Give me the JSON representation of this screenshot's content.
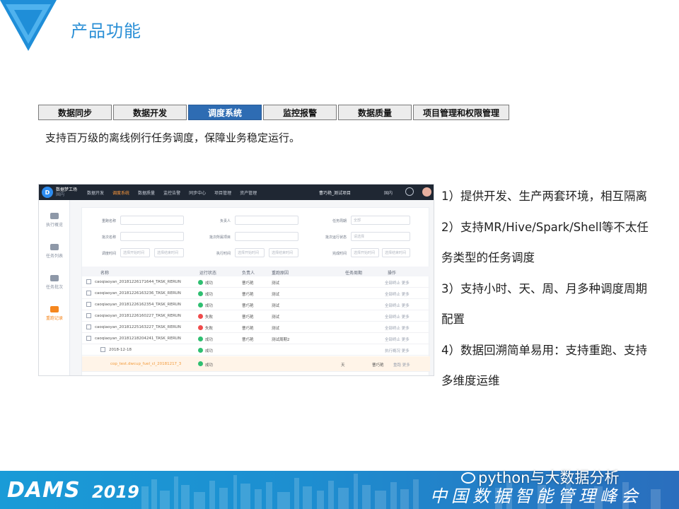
{
  "slide_title": "产品功能",
  "tabs": [
    {
      "label": "数据同步",
      "active": false
    },
    {
      "label": "数据开发",
      "active": false
    },
    {
      "label": "调度系统",
      "active": true
    },
    {
      "label": "监控报警",
      "active": false
    },
    {
      "label": "数据质量",
      "active": false
    },
    {
      "label": "项目管理和权限管理",
      "active": false
    }
  ],
  "subtitle": "支持百万级的离线例行任务调度，保障业务稳定运行。",
  "screenshot": {
    "brand": "数据梦工场",
    "brand_sub": "国内",
    "nav": [
      "数据开发",
      "调度系统",
      "数据质量",
      "监控告警",
      "同步中心",
      "项目管理",
      "资产管理"
    ],
    "nav_active_index": 1,
    "project": "曹巧艳_测试项目",
    "region": "国内",
    "sidebar": [
      {
        "label": "执行概览",
        "active": false
      },
      {
        "label": "任务列表",
        "active": false
      },
      {
        "label": "任务批次",
        "active": false
      },
      {
        "label": "重跑记录",
        "active": true
      }
    ],
    "filters": {
      "row1": [
        {
          "label": "重跑名称",
          "value": ""
        },
        {
          "label": "负责人",
          "value": ""
        },
        {
          "label": "任务周期",
          "value": "全部"
        }
      ],
      "row2": [
        {
          "label": "批次名称",
          "value": ""
        },
        {
          "label": "批次所属项目",
          "value": ""
        },
        {
          "label": "批次运行状态",
          "value": "请选择"
        }
      ],
      "row3": [
        {
          "label": "调度时间",
          "from": "选择开始时间",
          "to": "选择结束时间"
        },
        {
          "label": "执行时间",
          "from": "选择开始时间",
          "to": "选择结束时间"
        },
        {
          "label": "完成时间",
          "from": "选择开始时间",
          "to": "选择结束时间"
        }
      ]
    },
    "table_headers": [
      "名称",
      "运行状态",
      "负责人",
      "重跑原因",
      "任务周期",
      "操作"
    ],
    "rows": [
      {
        "name": "caoqiaoyan_20181226171644_TASK_RERUN",
        "status": "成功",
        "status_color": "#2fbf71",
        "owner": "曹巧艳",
        "reason": "测试",
        "period": "",
        "ops": "全部终止  更多"
      },
      {
        "name": "caoqiaoyan_20181226163236_TASK_RERUN",
        "status": "成功",
        "status_color": "#2fbf71",
        "owner": "曹巧艳",
        "reason": "测试",
        "period": "",
        "ops": "全部终止  更多"
      },
      {
        "name": "caoqiaoyan_20181226162354_TASK_RERUN",
        "status": "成功",
        "status_color": "#2fbf71",
        "owner": "曹巧艳",
        "reason": "测试",
        "period": "",
        "ops": "全部终止  更多"
      },
      {
        "name": "caoqiaoyan_20181226160227_TASK_RERUN",
        "status": "失败",
        "status_color": "#f04b4b",
        "owner": "曹巧艳",
        "reason": "测试",
        "period": "",
        "ops": "全部终止  更多"
      },
      {
        "name": "caoqiaoyan_20181225163227_TASK_RERUN",
        "status": "失败",
        "status_color": "#f04b4b",
        "owner": "曹巧艳",
        "reason": "测试",
        "period": "",
        "ops": "全部终止  更多"
      },
      {
        "name": "caoqiaoyan_20181218204241_TASK_RERUN",
        "status": "成功",
        "status_color": "#2fbf71",
        "owner": "曹巧艳",
        "reason": "测试周期2",
        "period": "",
        "ops": "全部终止  更多"
      }
    ],
    "sub_date_row": {
      "name": "2018-12-18",
      "status": "成功",
      "status_color": "#2fbf71",
      "ops": "执行概况  更多"
    },
    "highlight_row": {
      "name": "cop_test.dwcup_fuel_cl_20181217_3",
      "status": "成功",
      "status_color": "#2fbf71",
      "period": "天",
      "owner": "曹巧艳",
      "ops": "重跑  更多"
    }
  },
  "bullets": [
    "1）提供开发、生产两套环境，相互隔离",
    "2）支持MR/Hive/Spark/Shell等不太任",
    "务类型的任务调度",
    "3）支持小时、天、周、月多种调度周期",
    "配置",
    "4）数据回溯简单易用：支持重跑、支持",
    "多维度运维"
  ],
  "footer": {
    "brand": "DAMS",
    "year": "2019",
    "summit": "中国数据智能管理峰会",
    "wechat": "python与大数据分析"
  },
  "colors": {
    "accent_blue": "#2a8fd6",
    "tab_active": "#2e6cb3",
    "footer_blue": "#1d8ed0",
    "orange": "#f5871f"
  }
}
